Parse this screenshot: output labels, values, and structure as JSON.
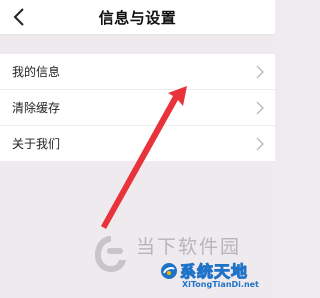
{
  "navbar": {
    "title": "信息与设置",
    "back_icon": "chevron-left-icon"
  },
  "menu": {
    "items": [
      {
        "label": "我的信息"
      },
      {
        "label": "清除缓存"
      },
      {
        "label": "关于我们"
      }
    ]
  },
  "colors": {
    "background": "#efeaee",
    "annotation_arrow": "#e8333a",
    "watermark_blue": "#1e73c8"
  },
  "watermark": {
    "site_name": "当下软件园",
    "brand_name": "系统天地",
    "brand_domain": "XiTongTianDi.net"
  }
}
